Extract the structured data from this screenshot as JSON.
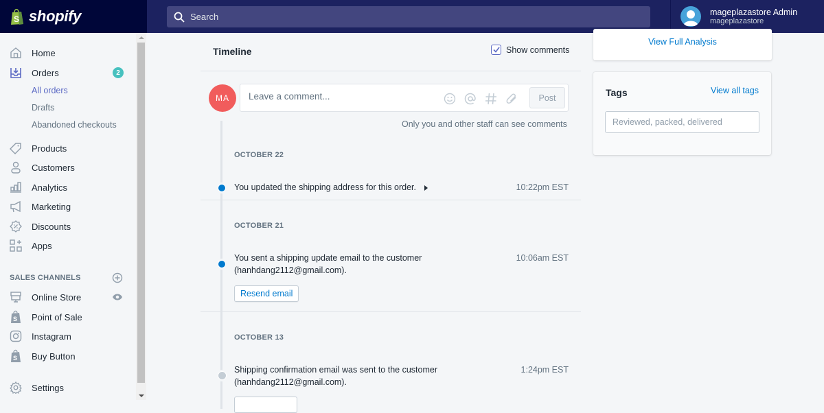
{
  "topbar": {
    "logo_text": "shopify",
    "search_placeholder": "Search",
    "user_name": "mageplazastore Admin",
    "store_name": "mageplazastore"
  },
  "sidebar": {
    "items": [
      {
        "label": "Home",
        "icon": "home-icon"
      },
      {
        "label": "Orders",
        "icon": "orders-icon",
        "badge": "2"
      },
      {
        "label": "Products",
        "icon": "tag-icon"
      },
      {
        "label": "Customers",
        "icon": "person-icon"
      },
      {
        "label": "Analytics",
        "icon": "bar-chart-icon"
      },
      {
        "label": "Marketing",
        "icon": "megaphone-icon"
      },
      {
        "label": "Discounts",
        "icon": "discount-icon"
      },
      {
        "label": "Apps",
        "icon": "apps-icon"
      }
    ],
    "order_subitems": [
      {
        "label": "All orders",
        "active": true
      },
      {
        "label": "Drafts",
        "active": false
      },
      {
        "label": "Abandoned checkouts",
        "active": false
      }
    ],
    "sales_channels_title": "SALES CHANNELS",
    "channels": [
      {
        "label": "Online Store",
        "icon": "store-icon"
      },
      {
        "label": "Point of Sale",
        "icon": "shopify-bag-icon"
      },
      {
        "label": "Instagram",
        "icon": "instagram-icon"
      },
      {
        "label": "Buy Button",
        "icon": "shopify-bag-icon"
      }
    ],
    "settings_label": "Settings"
  },
  "timeline": {
    "title": "Timeline",
    "show_comments_label": "Show comments",
    "show_comments_checked": true,
    "avatar_initials": "MA",
    "comment_placeholder": "Leave a comment...",
    "post_label": "Post",
    "staff_note": "Only you and other staff can see comments",
    "groups": [
      {
        "date": "OCTOBER 22",
        "events": [
          {
            "text": "You updated the shipping address for this order.",
            "time": "10:22pm EST",
            "expandable": true
          }
        ]
      },
      {
        "date": "OCTOBER 21",
        "events": [
          {
            "text_line1": "You sent a shipping update email to the customer",
            "text_line2": "(hanhdang2112@gmail.com).",
            "time": "10:06am EST",
            "button": "Resend email"
          }
        ]
      },
      {
        "date": "OCTOBER 13",
        "events": [
          {
            "text_line1": "Shipping confirmation email was sent to the customer",
            "text_line2": "(hanhdang2112@gmail.com).",
            "time": "1:24pm EST"
          }
        ]
      }
    ]
  },
  "right": {
    "analysis_link": "View Full Analysis",
    "tags_title": "Tags",
    "tags_link": "View all tags",
    "tags_placeholder": "Reviewed, packed, delivered"
  },
  "colors": {
    "topbar": "#1c2260",
    "logo_bg": "#000639",
    "accent_link": "#007ace",
    "nav_active": "#5c6ac4",
    "badge": "#47c1bf",
    "avatar": "#f15c5c"
  }
}
